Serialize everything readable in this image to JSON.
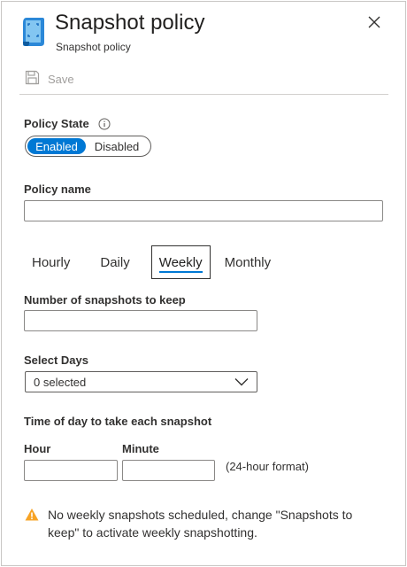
{
  "header": {
    "title": "Snapshot policy",
    "subtitle": "Snapshot policy",
    "icon": "snapshot-policy-icon",
    "close_icon": "close-icon"
  },
  "toolbar": {
    "save_label": "Save",
    "save_icon": "save-icon"
  },
  "policy_state": {
    "label": "Policy State",
    "info_icon": "info-icon",
    "options": [
      "Enabled",
      "Disabled"
    ],
    "selected": "Enabled"
  },
  "policy_name": {
    "label": "Policy name",
    "value": ""
  },
  "tabs": [
    {
      "label": "Hourly"
    },
    {
      "label": "Daily"
    },
    {
      "label": "Weekly"
    },
    {
      "label": "Monthly"
    }
  ],
  "active_tab": "Weekly",
  "snapshots_to_keep": {
    "label": "Number of snapshots to keep",
    "value": ""
  },
  "select_days": {
    "label": "Select Days",
    "value": "0 selected"
  },
  "time_of_day": {
    "label": "Time of day to take each snapshot",
    "hour_label": "Hour",
    "hour_value": "",
    "minute_label": "Minute",
    "minute_value": "",
    "format_hint": "(24-hour format)"
  },
  "warning": {
    "icon": "warning-icon",
    "text": "No weekly snapshots scheduled, change \"Snapshots to keep\" to activate weekly snapshotting."
  },
  "colors": {
    "accent": "#0078d4",
    "warning": "#f7a325",
    "text": "#323130",
    "disabled_text": "#a19f9d",
    "border": "#8a8886"
  }
}
